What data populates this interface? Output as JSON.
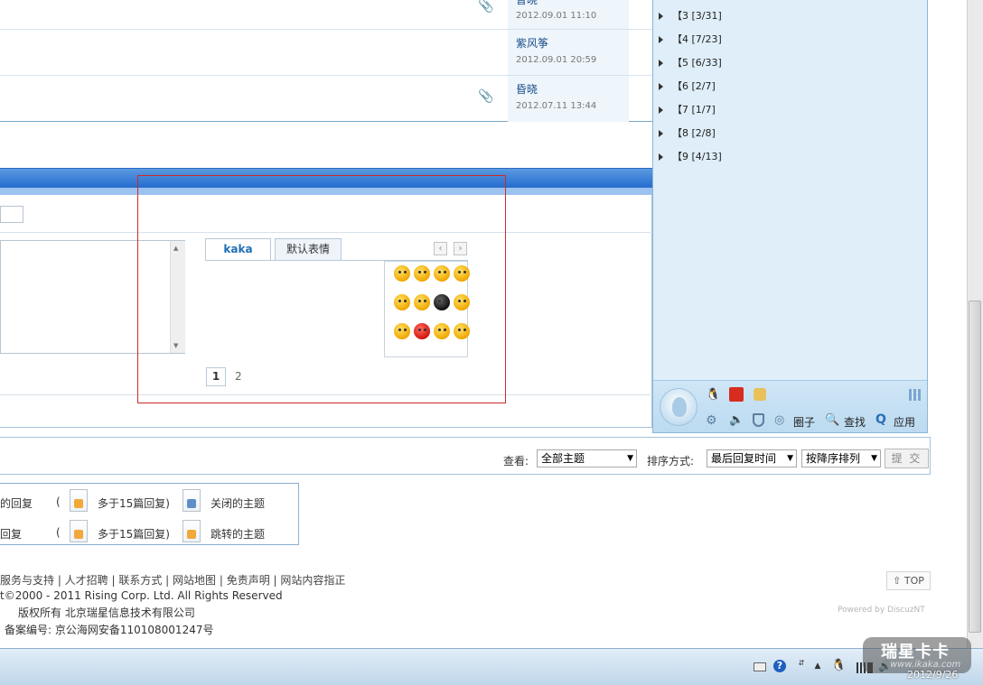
{
  "threads": [
    {
      "author": "昏晓",
      "time": "2012.09.01 11:10",
      "attachment": true
    },
    {
      "author": "紫风筝",
      "time": "2012.09.01 20:59",
      "attachment": false
    },
    {
      "author": "昏晓",
      "time": "2012.07.11 13:44",
      "attachment": true
    }
  ],
  "editor": {
    "tabs": [
      {
        "label": "kaka"
      },
      {
        "label": "默认表情"
      }
    ],
    "prev_arrow": "‹",
    "next_arrow": "›",
    "pages": [
      "1",
      "2"
    ]
  },
  "sort_bar": {
    "view_label": "查看:",
    "view_value": "全部主题",
    "sort_label": "排序方式:",
    "sort_value": "最后回复时间",
    "order_value": "按降序排列",
    "submit_label": "提 交"
  },
  "legend": {
    "row1": {
      "left_text": "的回复",
      "paren": "(",
      "hot_text": "多于15篇回复)",
      "closed_text": "关闭的主题"
    },
    "row2": {
      "left_text": "回复",
      "paren": "(",
      "hot_text": "多于15篇回复)",
      "moved_text": "跳转的主题"
    }
  },
  "footer": {
    "links": "服务与支持 | 人才招聘 | 联系方式 | 网站地图 | 免责声明 | 网站内容指正",
    "copyright": "t©2000 - 2011 Rising Corp. Ltd.  All Rights Reserved",
    "rights": "版权所有 北京瑞星信息技术有限公司",
    "icp": "备案编号: 京公海网安备110108001247号",
    "top_label": "TOP",
    "powered": "Powered by DiscuzNT"
  },
  "qq_panel": {
    "groups": [
      {
        "label": "【3  [3/31]"
      },
      {
        "label": "【4  [7/23]"
      },
      {
        "label": "【5  [6/33]"
      },
      {
        "label": "【6  [2/7]"
      },
      {
        "label": "【7  [1/7]"
      },
      {
        "label": "【8  [2/8]"
      },
      {
        "label": "【9  [4/13]"
      }
    ],
    "bottom": {
      "circle_label": "圈子",
      "search_label": "查找",
      "apps_label": "应用"
    }
  },
  "taskbar": {
    "clock_time": "",
    "clock_date": "2012/9/26"
  },
  "watermark": {
    "title": "瑞星卡卡",
    "url": "www.ikaka.com"
  }
}
